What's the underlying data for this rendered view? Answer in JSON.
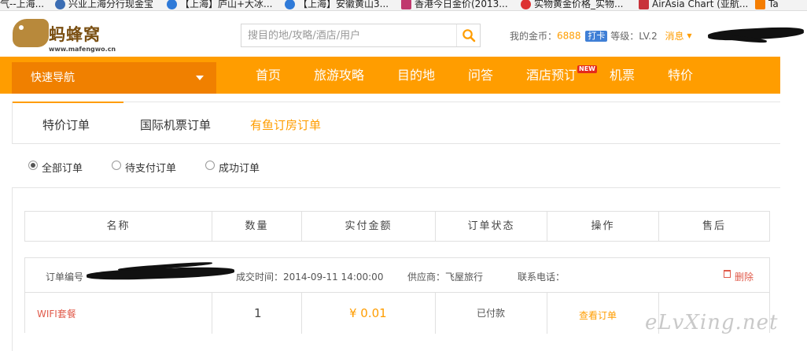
{
  "bookmarks": [
    {
      "label": "气--上海...",
      "icon": "page-icon",
      "color": "#9aa7b6"
    },
    {
      "label": "兴业上海分行现金宝",
      "icon": "bank-icon",
      "color": "#3b6db3"
    },
    {
      "label": "【上海】庐山+大冰...",
      "icon": "refresh-icon",
      "color": "#2f7ad8"
    },
    {
      "label": "【上海】安徽黄山3...",
      "icon": "refresh-icon",
      "color": "#2f7ad8"
    },
    {
      "label": "香港今日金价(2013...",
      "icon": "gem-icon",
      "color": "#c0396e"
    },
    {
      "label": "实物黄金价格_实物...",
      "icon": "target-icon",
      "color": "#d33"
    },
    {
      "label": "AirAsia Chart (亚航...",
      "icon": "airasia-icon",
      "color": "#c8323a"
    },
    {
      "label": "Ta",
      "icon": "blogger-icon",
      "color": "#f57d00"
    }
  ],
  "header": {
    "logo_text": "蚂蜂窝",
    "logo_url": "www.mafengwo.cn",
    "search_placeholder": "搜目的地/攻略/酒店/用户",
    "coins_label": "我的金币：",
    "coins_value": "6888",
    "checkin_label": "打卡",
    "level_label": "等级：LV.2",
    "messages_label": "消息"
  },
  "nav": {
    "quick_nav": "快速导航",
    "items": [
      "首页",
      "旅游攻略",
      "目的地",
      "问答",
      "酒店预订",
      "机票",
      "特价"
    ],
    "new_badge": "NEW"
  },
  "tabs": [
    "特价订单",
    "国际机票订单",
    "有鱼订房订单"
  ],
  "filters": {
    "options": [
      "全部订单",
      "待支付订单",
      "成功订单"
    ],
    "selected": "全部订单"
  },
  "table": {
    "headers": [
      "名称",
      "数量",
      "实付金额",
      "订单状态",
      "操作",
      "售后"
    ]
  },
  "order": {
    "number_label": "订单编号",
    "time_label": "成交时间：2014-09-11 14:00:00",
    "supplier_label": "供应商：飞屋旅行",
    "phone_label": "联系电话：",
    "delete_label": "删除",
    "item": {
      "name": "WIFI套餐",
      "quantity": "1",
      "amount": "¥ 0.01",
      "status": "已付款",
      "action": "查看订单",
      "after_sale": ""
    }
  },
  "watermark": "eLvXing.net",
  "colors": {
    "brand_orange": "#ff9d00",
    "quick_nav_orange": "#f08000",
    "delete_red": "#e05a4a",
    "checkin_blue": "#3f7fd6"
  }
}
